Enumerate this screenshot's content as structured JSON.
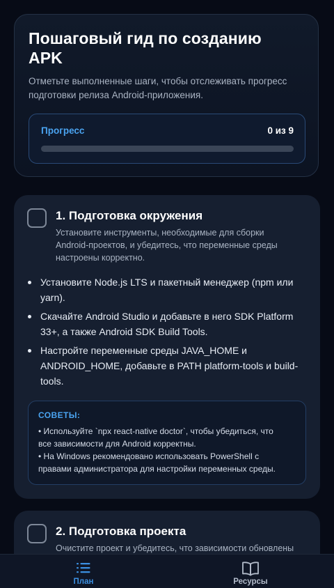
{
  "hero": {
    "title_line1": "Пошаговый гид по созданию",
    "title_line2": "APK",
    "subtitle_line1": "Отметьте выполненные шаги, чтобы отслеживать прогресс",
    "subtitle_line2": "подготовки релиза Android-приложения.",
    "progress_label": "Прогресс",
    "progress_count": "0 из 9",
    "progress_fraction": 0
  },
  "steps": [
    {
      "title": "1. Подготовка окружения",
      "checked": false,
      "desc_lines": [
        "Установите инструменты, необходимые для сборки",
        "Android-проектов, и убедитесь, что переменные среды",
        "настроены корректно."
      ],
      "items": [
        [
          "Установите Node.js LTS и пакетный менеджер (npm или",
          "yarn)."
        ],
        [
          "Скачайте Android Studio и добавьте в него SDK Platform",
          "33+, а также Android SDK Build Tools."
        ],
        [
          "Настройте переменные среды JAVA_HOME и",
          "ANDROID_HOME, добавьте в PATH platform-tools и build-",
          "tools."
        ]
      ],
      "tips": {
        "title": "СОВЕТЫ:",
        "lines": [
          "• Используйте `npx react-native doctor`, чтобы убедиться, что",
          "все зависимости для Android корректны.",
          "• На Windows рекомендовано использовать PowerShell с",
          "правами администратора для настройки переменных среды."
        ]
      }
    },
    {
      "title": "2. Подготовка проекта",
      "checked": false,
      "desc_lines": [
        "Очистите проект и убедитесь, что зависимости обновлены"
      ]
    }
  ],
  "nav": {
    "plan_label": "План",
    "plan_icon": "list-icon",
    "resources_label": "Ресурсы",
    "resources_icon": "book-icon",
    "active": "plan"
  },
  "colors": {
    "background": "#070b16",
    "card": "#161f30",
    "accent": "#4aa3f0",
    "nav_active": "#3b8fe0"
  }
}
